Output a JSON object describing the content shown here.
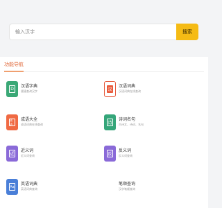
{
  "search": {
    "placeholder": "输入汉字",
    "button_label": "搜索"
  },
  "nav": {
    "section_title": "功能导航",
    "items": [
      {
        "icon": "dictionary-d-icon",
        "glyph": "D",
        "color": "#3aa876",
        "title": "汉语字典",
        "desc": "便捷查询汉字"
      },
      {
        "icon": "dictionary-han-icon",
        "glyph": "汉",
        "color": "#e65a3c",
        "title": "汉语词典",
        "desc": "汉语词典在线查询"
      },
      {
        "icon": "idiom-icon",
        "glyph": "成语",
        "color": "#f06a43",
        "title": "成语大全",
        "desc": "成语词典在线查询"
      },
      {
        "icon": "poem-icon",
        "glyph": "诗",
        "color": "#35a67a",
        "title": "诗词名句",
        "desc": "古诗文、诗词、名句"
      },
      {
        "icon": "synonym-icon",
        "glyph": "近",
        "color": "#8a6ad8",
        "title": "近义词",
        "desc": "近义词查询"
      },
      {
        "icon": "antonym-icon",
        "glyph": "反",
        "color": "#8a6ad8",
        "title": "反义词",
        "desc": "反义词查询"
      },
      {
        "icon": "english-dict-icon",
        "glyph": "Aa",
        "color": "#4a7fd8",
        "title": "英语词典",
        "desc": "英语词典查询"
      },
      {
        "icon": "stroke-icon",
        "glyph": "",
        "color": "",
        "title": "笔顺查询",
        "desc": "汉字笔顺查询"
      }
    ]
  }
}
